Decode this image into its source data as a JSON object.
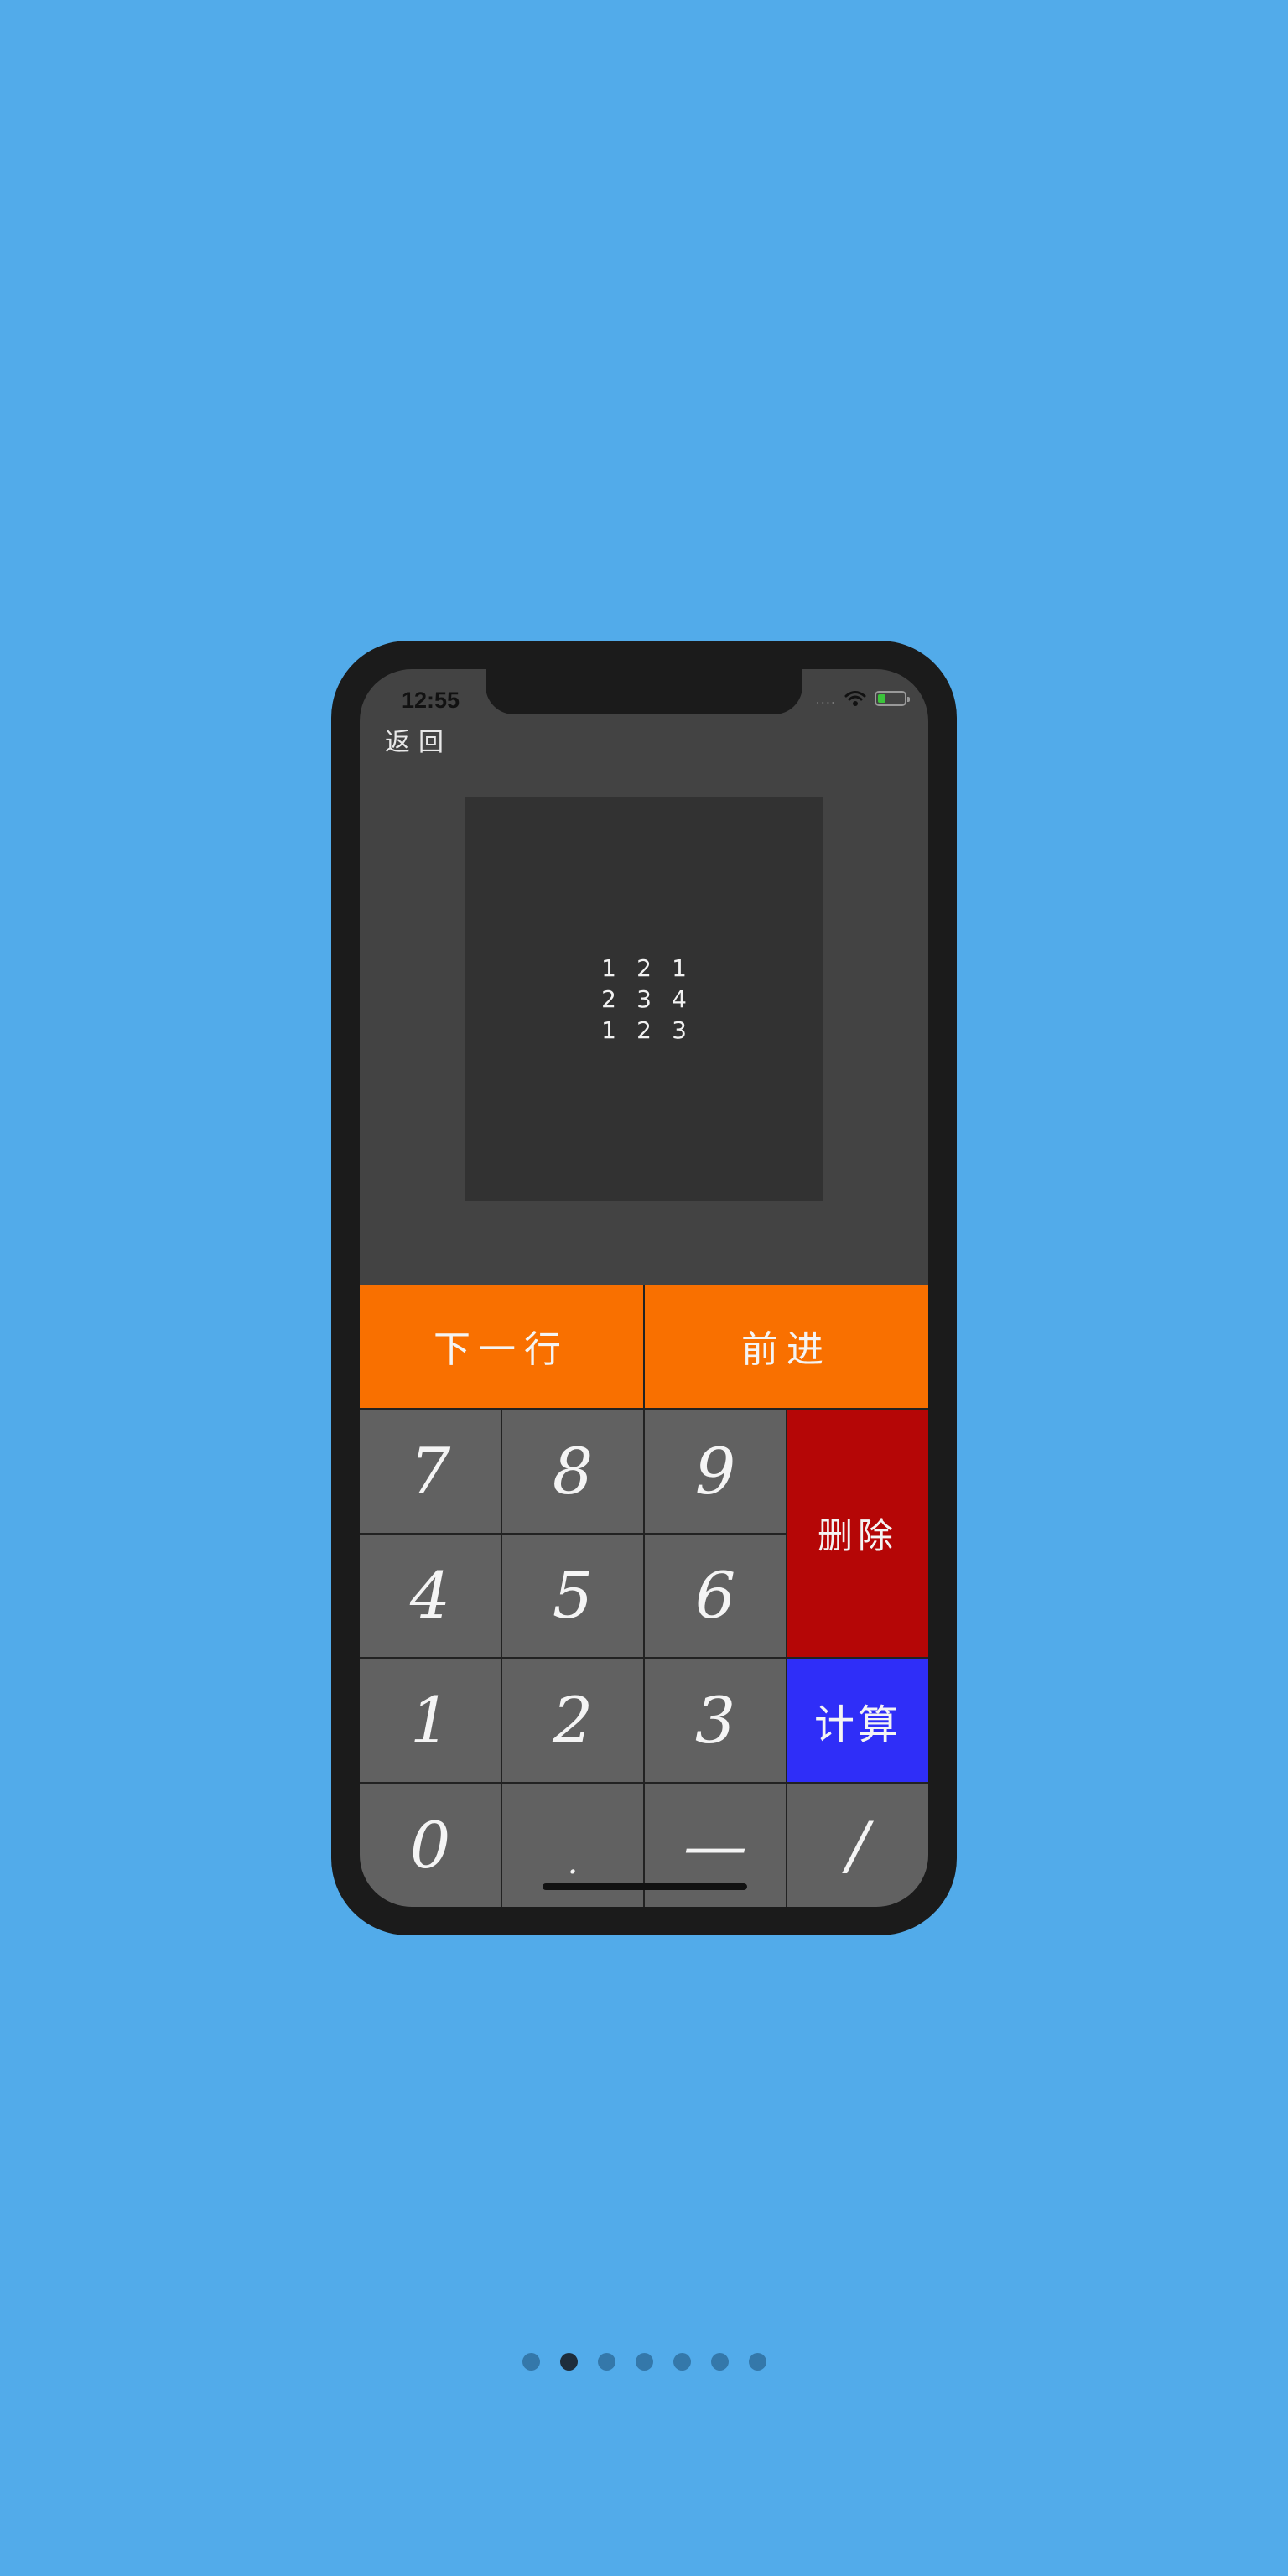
{
  "status_bar": {
    "time": "12:55",
    "signal": "....",
    "battery_level": 0.3
  },
  "nav": {
    "back_label": "返回"
  },
  "matrix": [
    [
      "1",
      "2",
      "1"
    ],
    [
      "2",
      "3",
      "4"
    ],
    [
      "1",
      "2",
      "3"
    ]
  ],
  "keypad": {
    "next_row_label": "下一行",
    "forward_label": "前进",
    "delete_label": "删除",
    "compute_label": "计算",
    "keys": {
      "k7": "7",
      "k8": "8",
      "k9": "9",
      "k4": "4",
      "k5": "5",
      "k6": "6",
      "k1": "1",
      "k2": "2",
      "k3": "3",
      "k0": "0",
      "dot": ".",
      "minus": "—",
      "slash": "/"
    }
  },
  "pager": {
    "count": 7,
    "active_index": 1
  },
  "colors": {
    "background": "#52abea",
    "orange": "#f97000",
    "red": "#b50606",
    "blue": "#2f2ef8",
    "key_gray": "#616161"
  }
}
